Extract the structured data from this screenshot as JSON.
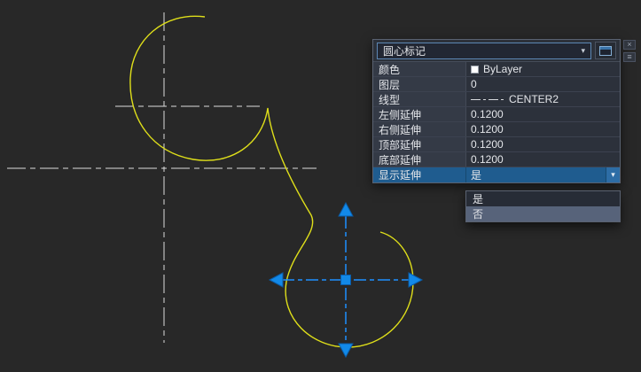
{
  "panel": {
    "header": {
      "dropdown_label": "圆心标记"
    },
    "rows": [
      {
        "label": "颜色",
        "value": "ByLayer"
      },
      {
        "label": "图层",
        "value": "0"
      },
      {
        "label": "线型",
        "value": "CENTER2"
      },
      {
        "label": "左侧延伸",
        "value": "0.1200"
      },
      {
        "label": "右侧延伸",
        "value": "0.1200"
      },
      {
        "label": "顶部延伸",
        "value": "0.1200"
      },
      {
        "label": "底部延伸",
        "value": "0.1200"
      },
      {
        "label": "显示延伸",
        "value": "是"
      }
    ],
    "dropdown_options": [
      {
        "label": "是"
      },
      {
        "label": "否"
      }
    ]
  },
  "colors": {
    "canvas_bg": "#282828",
    "spline_yellow": "#dfdf1a",
    "centerline_white": "#dcdcdc",
    "grip_blue": "#1289e8",
    "selected_mark_blue": "#1e90ff",
    "selection_row_blue": "#1f5c8f",
    "option_highlight": "#57637a"
  }
}
